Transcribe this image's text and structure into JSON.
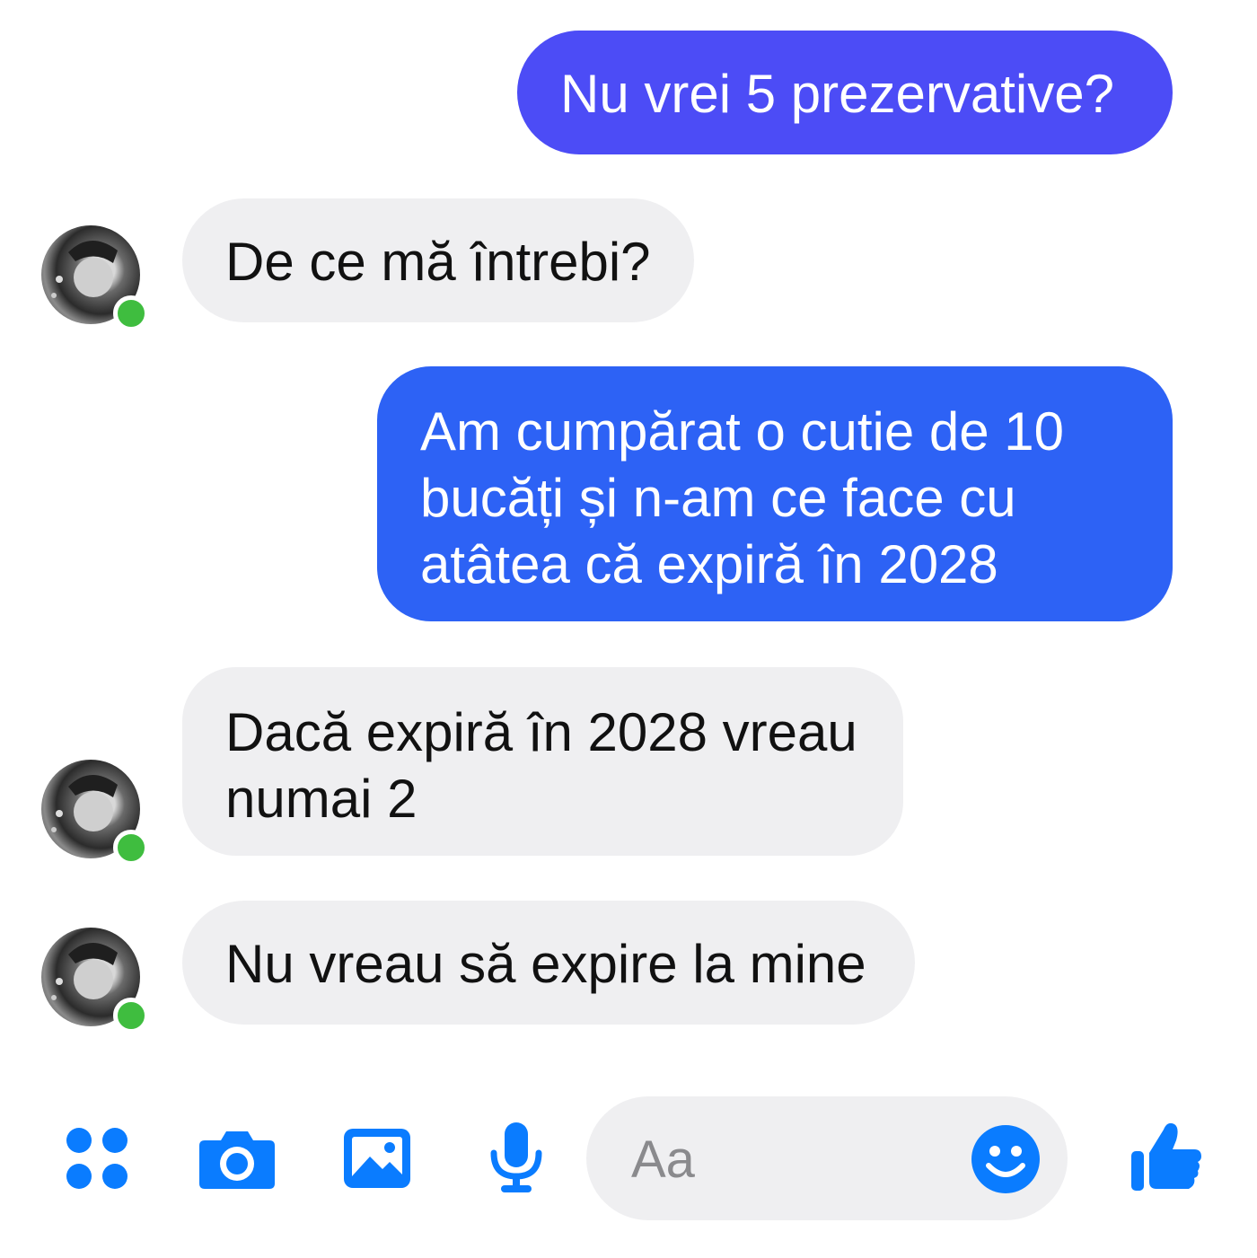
{
  "conversation": {
    "messages": [
      {
        "sender": "me",
        "text": "Nu vrei 5  prezervative?"
      },
      {
        "sender": "contact",
        "text": "De ce mă întrebi?"
      },
      {
        "sender": "me",
        "text": "Am cumpărat o cutie de 10\nbucăți și n-am ce face cu\natâtea că expiră în 2028"
      },
      {
        "sender": "contact",
        "text": "Dacă expiră în 2028 vreau\nnumai 2"
      },
      {
        "sender": "contact",
        "text": "Nu vreau să expire la mine"
      }
    ]
  },
  "composer": {
    "placeholder": "Aa"
  },
  "icons": {
    "apps": "apps-grid-icon",
    "camera": "camera-icon",
    "gallery": "image-gallery-icon",
    "microphone": "microphone-icon",
    "emoji": "smiley-emoji-icon",
    "like": "thumbs-up-icon"
  },
  "colors": {
    "accent": "#0a7cff",
    "outgoing_bubble_1": "#4c4cf6",
    "outgoing_bubble_2": "#2d62f5",
    "incoming_bubble": "#efeff1",
    "presence_online": "#3fbd3f"
  }
}
